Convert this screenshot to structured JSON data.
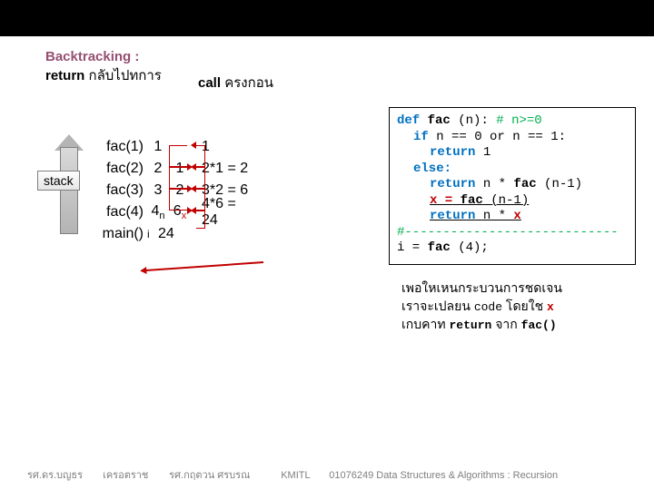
{
  "heading": {
    "line1": "Backtracking :",
    "line2_bold": "return",
    "line2_thai": " กลับไปทการ"
  },
  "call_label": {
    "bold": "call",
    "rest": " ครงกอน"
  },
  "stack_label": "stack",
  "stack_rows": [
    {
      "label": "fac(1)",
      "ret": "1",
      "mid": "",
      "out": "1"
    },
    {
      "label": "fac(2)",
      "ret": "2",
      "mid": "1",
      "out": "2*1 = 2"
    },
    {
      "label": "fac(3)",
      "ret": "3",
      "mid": "2",
      "out": "3*2 = 6"
    },
    {
      "label": "fac(4)",
      "ret": "4",
      "mid": "6",
      "out": "4*6 = 24"
    }
  ],
  "sublabels": {
    "n": "n",
    "x": "x"
  },
  "main_row": {
    "label": "main()",
    "i": "i",
    "val": "24"
  },
  "code": {
    "def": "def",
    "fac": "fac",
    "args": " (n):",
    "cm1": "  # n>=0",
    "if": "if",
    "cond": " n == 0 or n == 1:",
    "ret1": "return",
    "one": " 1",
    "else": "else:",
    "ret2a": "return",
    "ret2b": "   n *",
    "fac2": " fac",
    "ret2c": " (n-1)",
    "xline_a": "x =",
    "xline_fac": " fac",
    "xline_b": " (n-1)",
    "ret3a": "return",
    "ret3b": "   n *",
    "xvar": " x",
    "sep": "#----------------------------",
    "call_i": "i  =  ",
    "call_fac": "fac",
    "call_arg": " (4);"
  },
  "note": {
    "l1": "เพอใหเหนกระบวนการชดเจน",
    "l2a": "เราจะเปลยน     ",
    "l2_code": "code",
    "l2b": " โดยใช   ",
    "l2_x": "x",
    "l3a": "เกบคาท           ",
    "l3_ret": "return",
    "l3b": " จาก ",
    "l3_fac": "fac()"
  },
  "footer": {
    "a": "รศ.ดร.บญธร",
    "b": "เครอตราช",
    "c": "รศ.กฤตวน  ศรบรณ",
    "d": "KMITL",
    "e": "01076249 Data Structures & Algorithms : Recursion"
  }
}
